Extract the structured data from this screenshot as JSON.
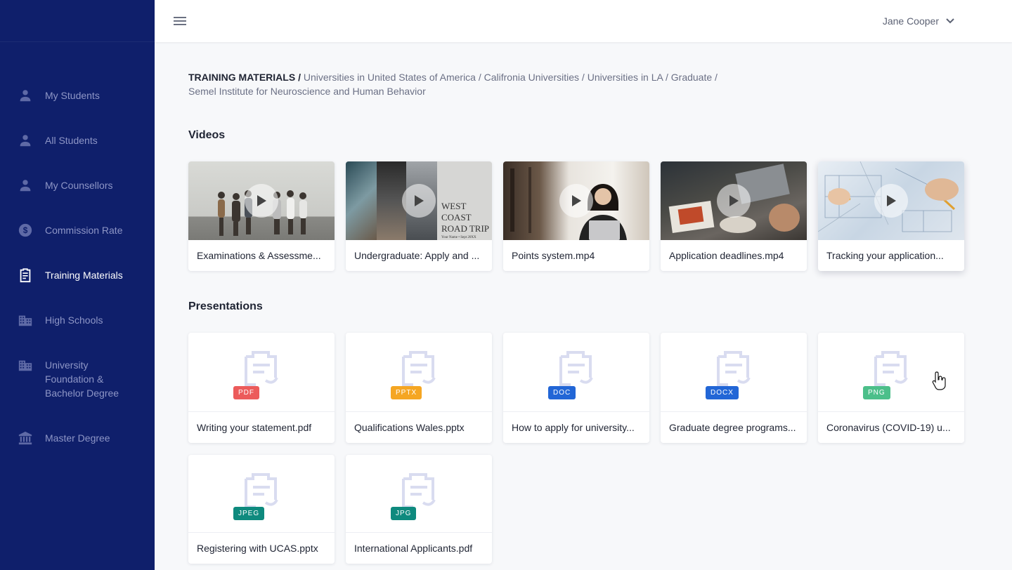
{
  "header": {
    "user_name": "Jane Cooper"
  },
  "sidebar": {
    "items": [
      {
        "label": "My Students",
        "icon": "person-icon"
      },
      {
        "label": "All Students",
        "icon": "person-icon"
      },
      {
        "label": "My Counsellors",
        "icon": "person-icon"
      },
      {
        "label": "Commission Rate",
        "icon": "dollar-icon"
      },
      {
        "label": "Training Materials",
        "icon": "clipboard-icon",
        "active": true
      },
      {
        "label": "High Schools",
        "icon": "building-icon"
      },
      {
        "label": "University Foundation & Bachelor Degree",
        "icon": "building-icon"
      },
      {
        "label": "Master Degree",
        "icon": "bank-icon"
      }
    ]
  },
  "breadcrumb": {
    "root": "TRAINING MATERIALS",
    "items": [
      "Universities in United States of America",
      "Califronia Universities",
      "Universities in LA",
      "Graduate",
      "Semel Institute for Neuroscience and Human Behavior"
    ]
  },
  "videos": {
    "title": "Videos",
    "items": [
      {
        "title": "Examinations & Assessme..."
      },
      {
        "title": "Undergraduate: Apply and ...",
        "thumb_text_1": "WEST COAST",
        "thumb_text_2": "ROAD TRIP",
        "thumb_text_3": "Your Name • Sept 20XX"
      },
      {
        "title": "Points system.mp4"
      },
      {
        "title": "Application deadlines.mp4"
      },
      {
        "title": "Tracking your application..."
      }
    ]
  },
  "presentations": {
    "title": "Presentations",
    "items": [
      {
        "title": "Writing your statement.pdf",
        "type": "PDF",
        "color": "#ec5b5b"
      },
      {
        "title": "Qualifications Wales.pptx",
        "type": "PPTX",
        "color": "#f5a623"
      },
      {
        "title": "How to apply for university...",
        "type": "DOC",
        "color": "#2266d6"
      },
      {
        "title": "Graduate degree programs...",
        "type": "DOCX",
        "color": "#2266d6"
      },
      {
        "title": "Coronavirus (COVID-19) u...",
        "type": "PNG",
        "color": "#4cbf8a"
      },
      {
        "title": "Registering with UCAS.pptx",
        "type": "JPEG",
        "color": "#0e8a7e"
      },
      {
        "title": "International Applicants.pdf",
        "type": "JPG",
        "color": "#0e8a7e"
      }
    ]
  },
  "colors": {
    "sidebar": "#0f1f6b",
    "active_text": "#ffffff",
    "inactive_text": "#8e96c6",
    "doc_icon": "#d9dcf0"
  }
}
